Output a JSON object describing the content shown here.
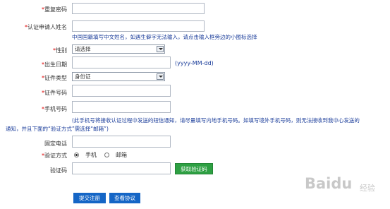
{
  "form": {
    "confirm_password": {
      "required": "*",
      "label": "重复密码"
    },
    "cert_name": {
      "required": "*",
      "label": "认证申请人姓名",
      "hint": "中国国籍填写中文姓名，如遇生僻字无法输入，请点击输入框旁边的小图标选择"
    },
    "gender": {
      "required": "*",
      "label": "性别",
      "value": "请选择"
    },
    "birthdate": {
      "required": "*",
      "label": "出生日期",
      "format_hint": "(yyyy-MM-dd)"
    },
    "id_type": {
      "required": "*",
      "label": "证件类型",
      "value": "身份证"
    },
    "id_number": {
      "required": "*",
      "label": "证件号码"
    },
    "mobile": {
      "required": "*",
      "label": "手机号码",
      "hint_line1": "(此手机号将接收认证过程中发送的短信通知，请尽量填写内地手机号码。如填写境外手机号码，则无法接收到我中心发送的",
      "hint_line2": "通知，并且下面的“验证方式”需选择“邮箱”)"
    },
    "landline": {
      "label": "固定电话"
    },
    "verify_method": {
      "required": "*",
      "label": "验证方式",
      "options": [
        "手机",
        "邮箱"
      ],
      "selected": "手机"
    },
    "verify_code": {
      "label": "验证码",
      "button": "获取验证码"
    }
  },
  "actions": {
    "submit": "提交注册",
    "agreement": "查看协议"
  },
  "colors": {
    "primary_button": "#1566c6",
    "code_button": "#2ea043",
    "hint_text": "#1a3c9a",
    "required_mark": "#e00000"
  },
  "watermark": {
    "brand": "Baidu",
    "sub": "经验"
  }
}
